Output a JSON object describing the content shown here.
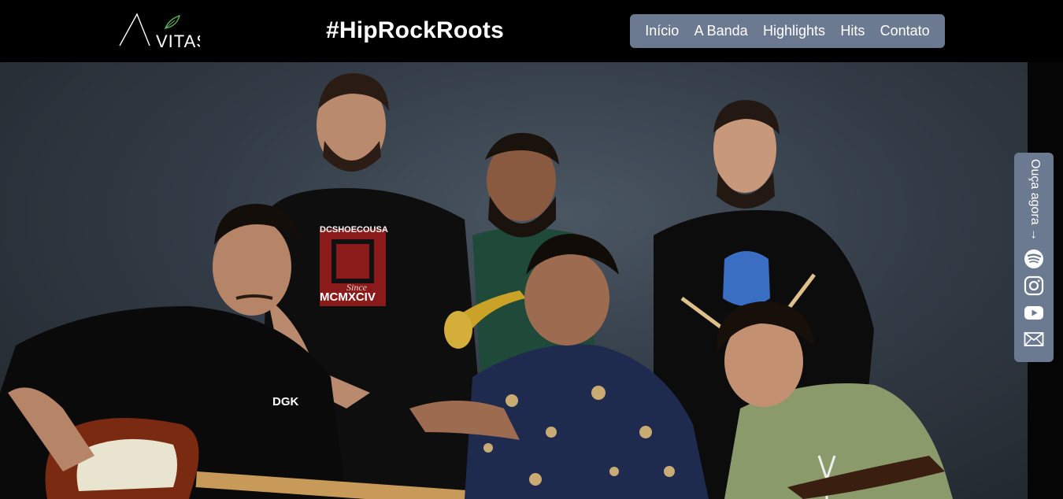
{
  "brand": {
    "logo_text": "VITAS",
    "tagline": "#HipRockRoots"
  },
  "nav": {
    "items": [
      "Início",
      "A Banda",
      "Highlights",
      "Hits",
      "Contato"
    ]
  },
  "listen": {
    "label": "Ouça agora",
    "arrow": "→",
    "icons": [
      "spotify-icon",
      "instagram-icon",
      "youtube-icon",
      "mail-icon"
    ]
  },
  "hero": {
    "shirt_text": {
      "brand": "DCSHOECOUSA",
      "since": "Since",
      "year": "MCMXCIV",
      "dgk": "DGK"
    }
  },
  "colors": {
    "nav_bg": "#6b7a90",
    "header_bg": "#000000",
    "text": "#ffffff"
  }
}
